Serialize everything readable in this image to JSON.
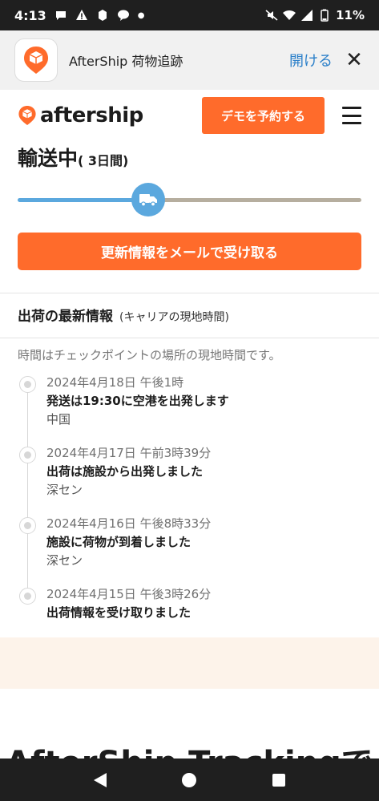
{
  "status_bar": {
    "time": "4:13",
    "battery": "11%"
  },
  "app_banner": {
    "app_name": "AfterShip 荷物追跡",
    "open_label": "開ける",
    "close_label": "✕"
  },
  "header": {
    "logo_text": "aftership",
    "demo_button": "デモを予約する",
    "brand_color": "#ff6b2b"
  },
  "shipment": {
    "status": "輸送中",
    "duration": "( 3日間)",
    "progress_fraction": 0.38
  },
  "subscribe": {
    "label": "更新情報をメールで受け取る"
  },
  "updates": {
    "title": "出荷の最新情報",
    "subtitle": "(キャリアの現地時間)",
    "timezone_note": "時間はチェックポイントの場所の現地時間です。",
    "events": [
      {
        "date": "2024年4月18日 午後1時",
        "message": "発送は19:30に空港を出発します",
        "location": "中国"
      },
      {
        "date": "2024年4月17日 午前3時39分",
        "message": "出荷は施設から出発しました",
        "location": "深セン"
      },
      {
        "date": "2024年4月16日 午後8時33分",
        "message": "施設に荷物が到着しました",
        "location": "深セン"
      },
      {
        "date": "2024年4月15日 午後3時26分",
        "message": "出荷情報を受け取りました",
        "location": ""
      }
    ]
  },
  "footer_heading": "AfterShip Trackingで"
}
